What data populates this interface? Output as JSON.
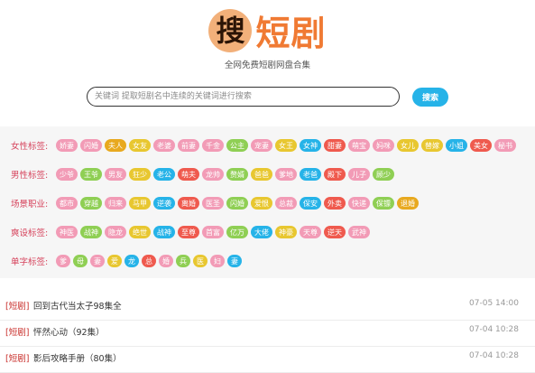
{
  "logo": {
    "char": "搜",
    "text": "短剧"
  },
  "subtitle": "全网免费短剧网盘合集",
  "search": {
    "placeholder": "关键词 提取短剧名中连续的关键词进行搜索",
    "button_label": "搜索"
  },
  "tag_rows": [
    {
      "label": "女性标签:",
      "tags": [
        {
          "t": "娇妻",
          "c": "#f29bb6"
        },
        {
          "t": "闪婚",
          "c": "#f29bb6"
        },
        {
          "t": "夫人",
          "c": "#e8a91f"
        },
        {
          "t": "女友",
          "c": "#e8c730"
        },
        {
          "t": "老婆",
          "c": "#f29bb6"
        },
        {
          "t": "前妻",
          "c": "#f29bb6"
        },
        {
          "t": "千金",
          "c": "#f29bb6"
        },
        {
          "t": "公主",
          "c": "#8fcf54"
        },
        {
          "t": "宠妻",
          "c": "#f29bb6"
        },
        {
          "t": "女王",
          "c": "#e8c730"
        },
        {
          "t": "女神",
          "c": "#26b3e8"
        },
        {
          "t": "甜妻",
          "c": "#ef5a4e"
        },
        {
          "t": "萌宝",
          "c": "#f29bb6"
        },
        {
          "t": "妈咪",
          "c": "#f29bb6"
        },
        {
          "t": "女儿",
          "c": "#e8c730"
        },
        {
          "t": "替嫁",
          "c": "#e8c730"
        },
        {
          "t": "小姐",
          "c": "#26b3e8"
        },
        {
          "t": "美女",
          "c": "#ef5a4e"
        },
        {
          "t": "秘书",
          "c": "#f29bb6"
        }
      ]
    },
    {
      "label": "男性标签:",
      "tags": [
        {
          "t": "少爷",
          "c": "#f29bb6"
        },
        {
          "t": "王爷",
          "c": "#8fcf54"
        },
        {
          "t": "男友",
          "c": "#f29bb6"
        },
        {
          "t": "狂少",
          "c": "#e8c730"
        },
        {
          "t": "老公",
          "c": "#26b3e8"
        },
        {
          "t": "萌夫",
          "c": "#ef5a4e"
        },
        {
          "t": "龙帅",
          "c": "#f29bb6"
        },
        {
          "t": "赘婿",
          "c": "#8fcf54"
        },
        {
          "t": "爸爸",
          "c": "#e8c730"
        },
        {
          "t": "爹地",
          "c": "#f29bb6"
        },
        {
          "t": "老爸",
          "c": "#26b3e8"
        },
        {
          "t": "殿下",
          "c": "#ef5a4e"
        },
        {
          "t": "儿子",
          "c": "#f29bb6"
        },
        {
          "t": "顾少",
          "c": "#8fcf54"
        }
      ]
    },
    {
      "label": "场景职业:",
      "tags": [
        {
          "t": "都市",
          "c": "#f29bb6"
        },
        {
          "t": "穿越",
          "c": "#8fcf54"
        },
        {
          "t": "归来",
          "c": "#f29bb6"
        },
        {
          "t": "马甲",
          "c": "#e8c730"
        },
        {
          "t": "逆袭",
          "c": "#26b3e8"
        },
        {
          "t": "离婚",
          "c": "#ef5a4e"
        },
        {
          "t": "医圣",
          "c": "#f29bb6"
        },
        {
          "t": "闪婚",
          "c": "#8fcf54"
        },
        {
          "t": "爱恨",
          "c": "#e8c730"
        },
        {
          "t": "总裁",
          "c": "#f29bb6"
        },
        {
          "t": "保安",
          "c": "#26b3e8"
        },
        {
          "t": "外卖",
          "c": "#ef5a4e"
        },
        {
          "t": "快递",
          "c": "#f29bb6"
        },
        {
          "t": "保镖",
          "c": "#8fcf54"
        },
        {
          "t": "退婚",
          "c": "#e8a91f"
        }
      ]
    },
    {
      "label": "爽设标签:",
      "tags": [
        {
          "t": "神医",
          "c": "#f29bb6"
        },
        {
          "t": "战神",
          "c": "#8fcf54"
        },
        {
          "t": "隐龙",
          "c": "#f29bb6"
        },
        {
          "t": "绝世",
          "c": "#e8c730"
        },
        {
          "t": "战神",
          "c": "#26b3e8"
        },
        {
          "t": "至尊",
          "c": "#ef5a4e"
        },
        {
          "t": "首富",
          "c": "#f29bb6"
        },
        {
          "t": "亿万",
          "c": "#8fcf54"
        },
        {
          "t": "大佬",
          "c": "#26b3e8"
        },
        {
          "t": "神豪",
          "c": "#e8c730"
        },
        {
          "t": "天尊",
          "c": "#f29bb6"
        },
        {
          "t": "逆天",
          "c": "#ef5a4e"
        },
        {
          "t": "武神",
          "c": "#f29bb6"
        }
      ]
    },
    {
      "label": "单字标签:",
      "tags": [
        {
          "t": "爹",
          "c": "#f29bb6"
        },
        {
          "t": "母",
          "c": "#8fcf54"
        },
        {
          "t": "妻",
          "c": "#f29bb6"
        },
        {
          "t": "爱",
          "c": "#e8c730"
        },
        {
          "t": "龙",
          "c": "#26b3e8"
        },
        {
          "t": "总",
          "c": "#ef5a4e"
        },
        {
          "t": "婚",
          "c": "#f29bb6"
        },
        {
          "t": "兵",
          "c": "#8fcf54"
        },
        {
          "t": "医",
          "c": "#e8c730"
        },
        {
          "t": "妇",
          "c": "#f29bb6"
        },
        {
          "t": "妻",
          "c": "#26b3e8"
        }
      ]
    }
  ],
  "list": [
    {
      "tag": "[短剧]",
      "title": "回到古代当太子98集全",
      "date": "07-05 14:00"
    },
    {
      "tag": "[短剧]",
      "title": "怦然心动（92集）",
      "date": "07-04 10:28"
    },
    {
      "tag": "[短剧]",
      "title": "影后攻略手册（80集）",
      "date": "07-04 10:28"
    }
  ]
}
